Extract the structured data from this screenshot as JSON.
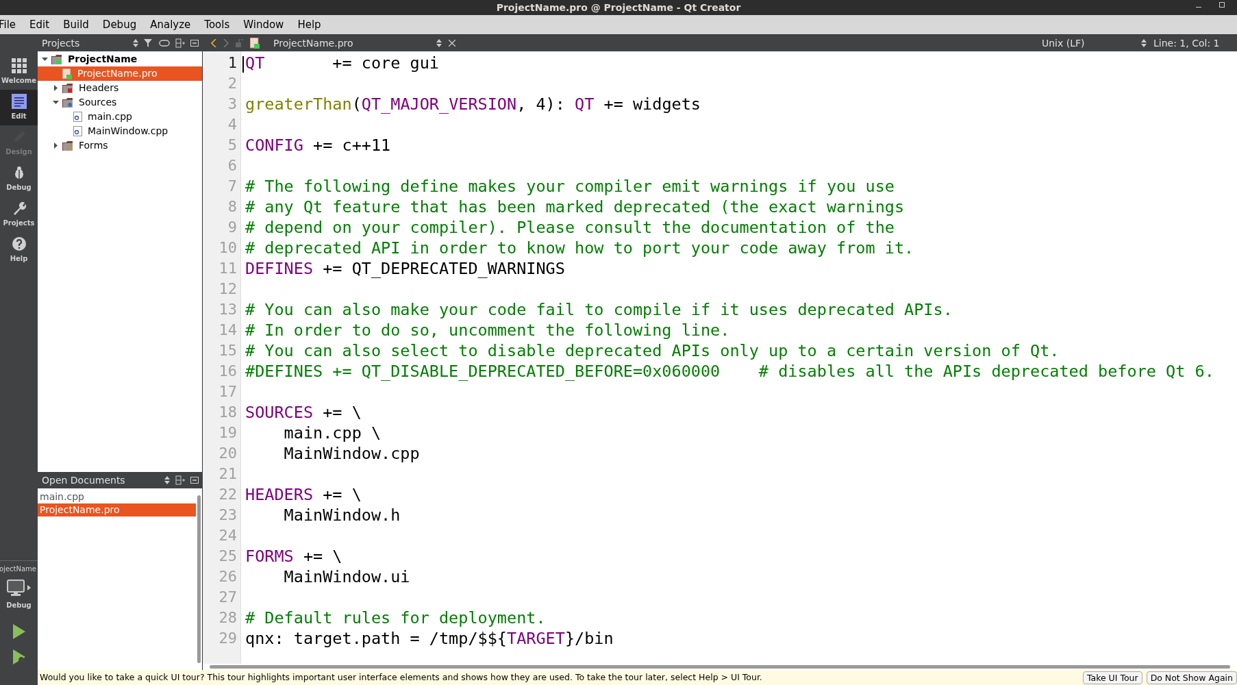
{
  "window": {
    "title": "ProjectName.pro @ ProjectName - Qt Creator"
  },
  "menu": [
    "File",
    "Edit",
    "Build",
    "Debug",
    "Analyze",
    "Tools",
    "Window",
    "Help"
  ],
  "modes": [
    {
      "label": "Welcome",
      "kind": "grid",
      "selected": false,
      "disabled": false
    },
    {
      "label": "Edit",
      "kind": "edit",
      "selected": true,
      "disabled": false
    },
    {
      "label": "Design",
      "kind": "pencil",
      "selected": false,
      "disabled": true
    },
    {
      "label": "Debug",
      "kind": "bug",
      "selected": false,
      "disabled": false
    },
    {
      "label": "Projects",
      "kind": "wrench",
      "selected": false,
      "disabled": false
    },
    {
      "label": "Help",
      "kind": "help",
      "selected": false,
      "disabled": false
    }
  ],
  "target": {
    "project": "ojectName",
    "config": "Debug"
  },
  "projects_panel": {
    "title": "Projects",
    "tree": [
      {
        "label": "ProjectName",
        "kind": "project",
        "expanded": true,
        "selected": false,
        "children": [
          {
            "label": "ProjectName.pro",
            "kind": "profile",
            "selected": true
          },
          {
            "label": "Headers",
            "kind": "headers",
            "expanded": false,
            "selected": false
          },
          {
            "label": "Sources",
            "kind": "sources",
            "expanded": true,
            "selected": false,
            "children": [
              {
                "label": "main.cpp",
                "kind": "cpp",
                "selected": false
              },
              {
                "label": "MainWindow.cpp",
                "kind": "cpp",
                "selected": false
              }
            ]
          },
          {
            "label": "Forms",
            "kind": "forms",
            "expanded": false,
            "selected": false
          }
        ]
      }
    ]
  },
  "open_documents": {
    "title": "Open Documents",
    "items": [
      {
        "label": "main.cpp",
        "selected": false
      },
      {
        "label": "ProjectName.pro",
        "selected": true
      }
    ]
  },
  "editor_toolbar": {
    "file": "ProjectName.pro",
    "line_endings": "Unix (LF)",
    "position": "Line: 1, Col: 1"
  },
  "code": [
    {
      "number": "1",
      "segments": [
        {
          "kind": "variable",
          "text": "QT"
        },
        {
          "kind": "plain",
          "text": "       += core gui"
        }
      ]
    },
    {
      "number": "2"
    },
    {
      "number": "3",
      "segments": [
        {
          "kind": "function",
          "text": "greaterThan"
        },
        {
          "kind": "plain",
          "text": "("
        },
        {
          "kind": "variable",
          "text": "QT_MAJOR_VERSION"
        },
        {
          "kind": "plain",
          "text": ", 4): "
        },
        {
          "kind": "variable",
          "text": "QT"
        },
        {
          "kind": "plain",
          "text": " += widgets"
        }
      ]
    },
    {
      "number": "4"
    },
    {
      "number": "5",
      "segments": [
        {
          "kind": "variable",
          "text": "CONFIG"
        },
        {
          "kind": "plain",
          "text": " += c++11"
        }
      ]
    },
    {
      "number": "6"
    },
    {
      "number": "7",
      "segments": [
        {
          "kind": "comment",
          "text": "# The following define makes your compiler emit warnings if you use"
        }
      ]
    },
    {
      "number": "8",
      "segments": [
        {
          "kind": "comment",
          "text": "# any Qt feature that has been marked deprecated (the exact warnings"
        }
      ]
    },
    {
      "number": "9",
      "segments": [
        {
          "kind": "comment",
          "text": "# depend on your compiler). Please consult the documentation of the"
        }
      ]
    },
    {
      "number": "10",
      "segments": [
        {
          "kind": "comment",
          "text": "# deprecated API in order to know how to port your code away from it."
        }
      ]
    },
    {
      "number": "11",
      "segments": [
        {
          "kind": "variable",
          "text": "DEFINES"
        },
        {
          "kind": "plain",
          "text": " += QT_DEPRECATED_WARNINGS"
        }
      ]
    },
    {
      "number": "12"
    },
    {
      "number": "13",
      "segments": [
        {
          "kind": "comment",
          "text": "# You can also make your code fail to compile if it uses deprecated APIs."
        }
      ]
    },
    {
      "number": "14",
      "segments": [
        {
          "kind": "comment",
          "text": "# In order to do so, uncomment the following line."
        }
      ]
    },
    {
      "number": "15",
      "segments": [
        {
          "kind": "comment",
          "text": "# You can also select to disable deprecated APIs only up to a certain version of Qt."
        }
      ]
    },
    {
      "number": "16",
      "segments": [
        {
          "kind": "comment",
          "text": "#DEFINES += QT_DISABLE_DEPRECATED_BEFORE=0x060000    # disables all the APIs deprecated before Qt 6."
        }
      ]
    },
    {
      "number": "17"
    },
    {
      "number": "18",
      "segments": [
        {
          "kind": "variable",
          "text": "SOURCES"
        },
        {
          "kind": "plain",
          "text": " += \\"
        }
      ]
    },
    {
      "number": "19",
      "segments": [
        {
          "kind": "plain",
          "text": "    main.cpp \\"
        }
      ]
    },
    {
      "number": "20",
      "segments": [
        {
          "kind": "plain",
          "text": "    MainWindow.cpp"
        }
      ]
    },
    {
      "number": "21"
    },
    {
      "number": "22",
      "segments": [
        {
          "kind": "variable",
          "text": "HEADERS"
        },
        {
          "kind": "plain",
          "text": " += \\"
        }
      ]
    },
    {
      "number": "23",
      "segments": [
        {
          "kind": "plain",
          "text": "    MainWindow.h"
        }
      ]
    },
    {
      "number": "24"
    },
    {
      "number": "25",
      "segments": [
        {
          "kind": "variable",
          "text": "FORMS"
        },
        {
          "kind": "plain",
          "text": " += \\"
        }
      ]
    },
    {
      "number": "26",
      "segments": [
        {
          "kind": "plain",
          "text": "    MainWindow.ui"
        }
      ]
    },
    {
      "number": "27"
    },
    {
      "number": "28",
      "segments": [
        {
          "kind": "comment",
          "text": "# Default rules for deployment."
        }
      ]
    },
    {
      "number": "29",
      "segments": [
        {
          "kind": "plain",
          "text": "qnx: target.path = /tmp/$${"
        },
        {
          "kind": "variable",
          "text": "TARGET"
        },
        {
          "kind": "plain",
          "text": "}/bin"
        }
      ]
    }
  ],
  "info_bar": {
    "message": "Would you like to take a quick UI tour? This tour highlights important user interface elements and shows how they are used. To take the tour later, select Help > UI Tour.",
    "buttons": [
      "Take UI Tour",
      "Do Not Show Again"
    ]
  }
}
